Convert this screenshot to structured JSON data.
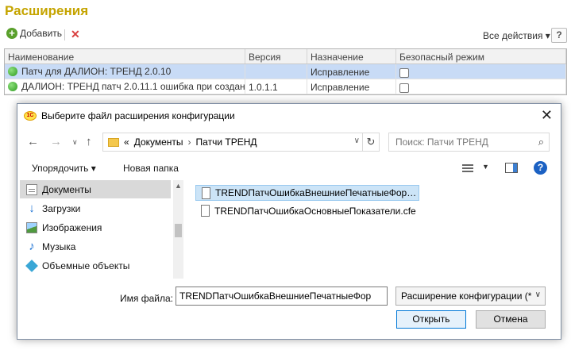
{
  "app": {
    "title": "Расширения",
    "toolbar": {
      "add_label": "Добавить",
      "all_actions_label": "Все действия",
      "help_label": "?"
    },
    "table": {
      "columns": [
        "Наименование",
        "Версия",
        "Назначение",
        "Безопасный режим"
      ],
      "rows": [
        {
          "name": "Патч для ДАЛИОН: ТРЕНД 2.0.10",
          "version": "",
          "purpose": "Исправление",
          "safe_mode": false
        },
        {
          "name": "ДАЛИОН: ТРЕНД патч 2.0.11.1 ошибка при создан…",
          "version": "1.0.1.1",
          "purpose": "Исправление",
          "safe_mode": false
        }
      ]
    }
  },
  "dialog": {
    "title": "Выберите файл расширения конфигурации",
    "path_prefix": "«",
    "breadcrumb": [
      "Документы",
      "Патчи ТРЕНД"
    ],
    "search_placeholder": "Поиск: Патчи ТРЕНД",
    "organize_label": "Упорядочить ▾",
    "new_folder_label": "Новая папка",
    "nav_items": [
      {
        "label": "Документы",
        "icon": "documents-icon",
        "selected": true
      },
      {
        "label": "Загрузки",
        "icon": "downloads-icon",
        "selected": false
      },
      {
        "label": "Изображения",
        "icon": "images-icon",
        "selected": false
      },
      {
        "label": "Музыка",
        "icon": "music-icon",
        "selected": false
      },
      {
        "label": "Объемные объекты",
        "icon": "3d-objects-icon",
        "selected": false
      }
    ],
    "files": [
      {
        "name": "TRENDПатчОшибкаВнешниеПечатныеФор…",
        "selected": true
      },
      {
        "name": "TRENDПатчОшибкаОсновныеПоказатели.cfe",
        "selected": false
      }
    ],
    "filename_label": "Имя файла:",
    "filename_value": "TRENDПатчОшибкаВнешниеПечатныеФор",
    "filetype_value": "Расширение конфигурации (*",
    "open_label": "Открыть",
    "cancel_label": "Отмена"
  },
  "colors": {
    "title": "#c5a400",
    "selection": "#c8dbf6",
    "accent": "#0078d7"
  }
}
